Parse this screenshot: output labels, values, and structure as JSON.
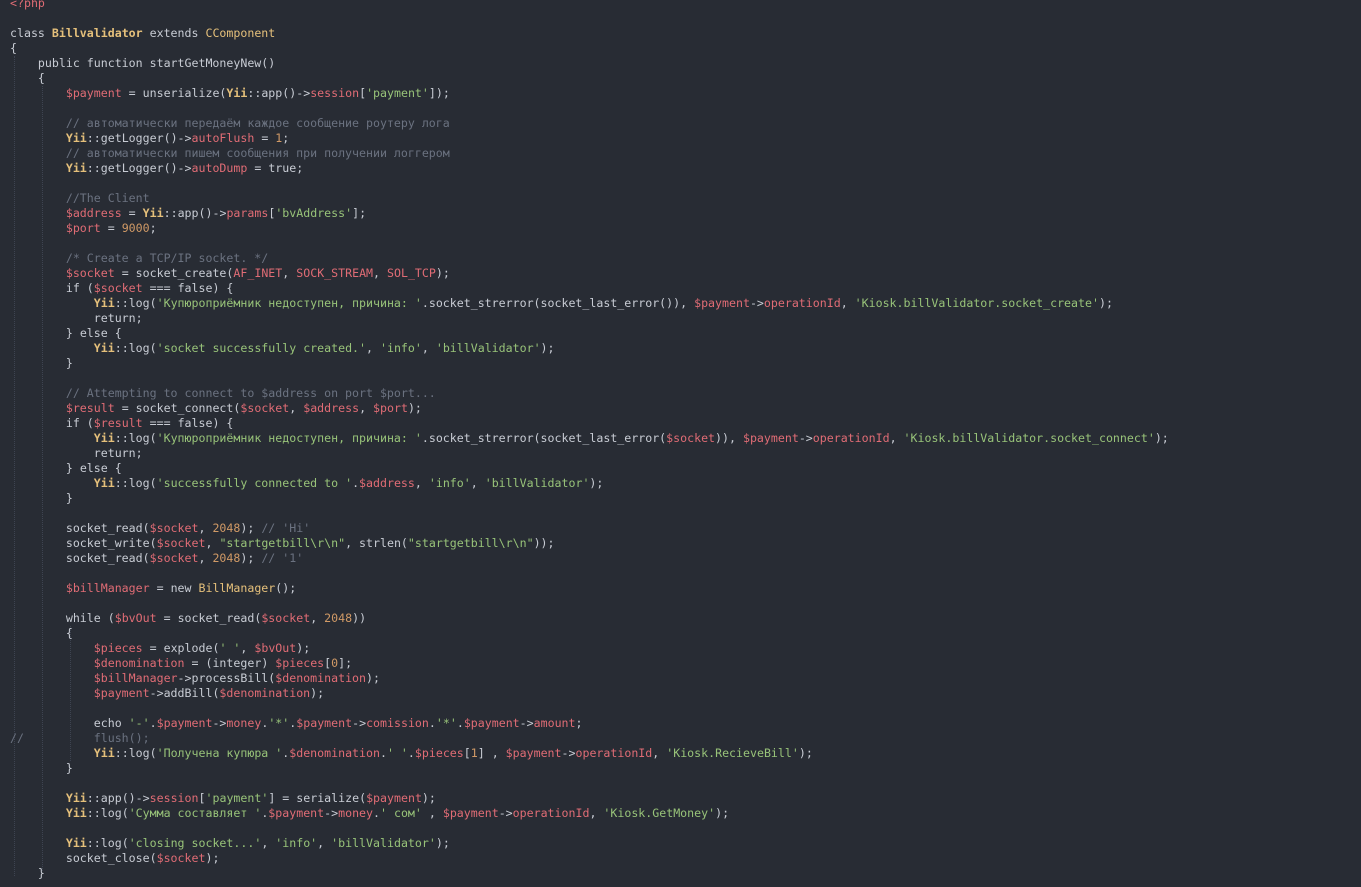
{
  "colors": {
    "background": "#282c34",
    "keyword": "#c8ccd4",
    "variable": "#e06c75",
    "class": "#e5c07b",
    "string": "#98c379",
    "number": "#d19a66",
    "comment": "#6b7280"
  },
  "lines": [
    [
      [
        "tag",
        "<?php"
      ]
    ],
    [],
    [
      [
        "kw",
        "class "
      ],
      [
        "cls",
        "Billvalidator"
      ],
      [
        "kw",
        " extends "
      ],
      [
        "typ",
        "CComponent"
      ]
    ],
    [
      [
        "plain",
        "{"
      ]
    ],
    [
      [
        "plain",
        "    "
      ],
      [
        "kw",
        "public function "
      ],
      [
        "fn",
        "startGetMoneyNew()"
      ]
    ],
    [
      [
        "plain",
        "    {"
      ]
    ],
    [
      [
        "plain",
        "        "
      ],
      [
        "var",
        "$payment"
      ],
      [
        "op",
        " = "
      ],
      [
        "fn",
        "unserialize("
      ],
      [
        "cls",
        "Yii"
      ],
      [
        "op",
        "::"
      ],
      [
        "fn",
        "app()->"
      ],
      [
        "prop",
        "session"
      ],
      [
        "plain",
        "["
      ],
      [
        "str",
        "'payment'"
      ],
      [
        "plain",
        "]);"
      ]
    ],
    [],
    [
      [
        "plain",
        "        "
      ],
      [
        "com",
        "// автоматически передаём каждое сообщение роутеру лога"
      ]
    ],
    [
      [
        "plain",
        "        "
      ],
      [
        "cls",
        "Yii"
      ],
      [
        "op",
        "::"
      ],
      [
        "fn",
        "getLogger()->"
      ],
      [
        "prop",
        "autoFlush"
      ],
      [
        "op",
        " = "
      ],
      [
        "num",
        "1"
      ],
      [
        "plain",
        ";"
      ]
    ],
    [
      [
        "plain",
        "        "
      ],
      [
        "com",
        "// автоматически пишем сообщения при получении логгером"
      ]
    ],
    [
      [
        "plain",
        "        "
      ],
      [
        "cls",
        "Yii"
      ],
      [
        "op",
        "::"
      ],
      [
        "fn",
        "getLogger()->"
      ],
      [
        "prop",
        "autoDump"
      ],
      [
        "op",
        " = "
      ],
      [
        "kw",
        "true"
      ],
      [
        "plain",
        ";"
      ]
    ],
    [],
    [
      [
        "plain",
        "        "
      ],
      [
        "com",
        "//The Client"
      ]
    ],
    [
      [
        "plain",
        "        "
      ],
      [
        "var",
        "$address"
      ],
      [
        "op",
        " = "
      ],
      [
        "cls",
        "Yii"
      ],
      [
        "op",
        "::"
      ],
      [
        "fn",
        "app()->"
      ],
      [
        "prop",
        "params"
      ],
      [
        "plain",
        "["
      ],
      [
        "str",
        "'bvAddress'"
      ],
      [
        "plain",
        "];"
      ]
    ],
    [
      [
        "plain",
        "        "
      ],
      [
        "var",
        "$port"
      ],
      [
        "op",
        " = "
      ],
      [
        "num",
        "9000"
      ],
      [
        "plain",
        ";"
      ]
    ],
    [],
    [
      [
        "plain",
        "        "
      ],
      [
        "com",
        "/* Create a TCP/IP socket. */"
      ]
    ],
    [
      [
        "plain",
        "        "
      ],
      [
        "var",
        "$socket"
      ],
      [
        "op",
        " = "
      ],
      [
        "fn",
        "socket_create("
      ],
      [
        "var",
        "AF_INET"
      ],
      [
        "plain",
        ", "
      ],
      [
        "var",
        "SOCK_STREAM"
      ],
      [
        "plain",
        ", "
      ],
      [
        "var",
        "SOL_TCP"
      ],
      [
        "plain",
        ");"
      ]
    ],
    [
      [
        "plain",
        "        "
      ],
      [
        "kw",
        "if "
      ],
      [
        "plain",
        "("
      ],
      [
        "var",
        "$socket"
      ],
      [
        "op",
        " === "
      ],
      [
        "kw",
        "false"
      ],
      [
        "plain",
        ") {"
      ]
    ],
    [
      [
        "plain",
        "            "
      ],
      [
        "cls",
        "Yii"
      ],
      [
        "op",
        "::"
      ],
      [
        "fn",
        "log("
      ],
      [
        "str",
        "'Купюроприёмник недоступен, причина: '"
      ],
      [
        "plain",
        "."
      ],
      [
        "fn",
        "socket_strerror(socket_last_error()), "
      ],
      [
        "var",
        "$payment"
      ],
      [
        "op",
        "->"
      ],
      [
        "prop",
        "operationId"
      ],
      [
        "plain",
        ", "
      ],
      [
        "str",
        "'Kiosk.billValidator.socket_create'"
      ],
      [
        "plain",
        ");"
      ]
    ],
    [
      [
        "plain",
        "            "
      ],
      [
        "kw",
        "return"
      ],
      [
        "plain",
        ";"
      ]
    ],
    [
      [
        "plain",
        "        } "
      ],
      [
        "kw",
        "else"
      ],
      [
        "plain",
        " {"
      ]
    ],
    [
      [
        "plain",
        "            "
      ],
      [
        "cls",
        "Yii"
      ],
      [
        "op",
        "::"
      ],
      [
        "fn",
        "log("
      ],
      [
        "str",
        "'socket successfully created.'"
      ],
      [
        "plain",
        ", "
      ],
      [
        "str",
        "'info'"
      ],
      [
        "plain",
        ", "
      ],
      [
        "str",
        "'billValidator'"
      ],
      [
        "plain",
        ");"
      ]
    ],
    [
      [
        "plain",
        "        }"
      ]
    ],
    [],
    [
      [
        "plain",
        "        "
      ],
      [
        "com",
        "// Attempting to connect to $address on port $port..."
      ]
    ],
    [
      [
        "plain",
        "        "
      ],
      [
        "var",
        "$result"
      ],
      [
        "op",
        " = "
      ],
      [
        "fn",
        "socket_connect("
      ],
      [
        "var",
        "$socket"
      ],
      [
        "plain",
        ", "
      ],
      [
        "var",
        "$address"
      ],
      [
        "plain",
        ", "
      ],
      [
        "var",
        "$port"
      ],
      [
        "plain",
        ");"
      ]
    ],
    [
      [
        "plain",
        "        "
      ],
      [
        "kw",
        "if "
      ],
      [
        "plain",
        "("
      ],
      [
        "var",
        "$result"
      ],
      [
        "op",
        " === "
      ],
      [
        "kw",
        "false"
      ],
      [
        "plain",
        ") {"
      ]
    ],
    [
      [
        "plain",
        "            "
      ],
      [
        "cls",
        "Yii"
      ],
      [
        "op",
        "::"
      ],
      [
        "fn",
        "log("
      ],
      [
        "str",
        "'Купюроприёмник недоступен, причина: '"
      ],
      [
        "plain",
        "."
      ],
      [
        "fn",
        "socket_strerror(socket_last_error("
      ],
      [
        "var",
        "$socket"
      ],
      [
        "plain",
        ")), "
      ],
      [
        "var",
        "$payment"
      ],
      [
        "op",
        "->"
      ],
      [
        "prop",
        "operationId"
      ],
      [
        "plain",
        ", "
      ],
      [
        "str",
        "'Kiosk.billValidator.socket_connect'"
      ],
      [
        "plain",
        ");"
      ]
    ],
    [
      [
        "plain",
        "            "
      ],
      [
        "kw",
        "return"
      ],
      [
        "plain",
        ";"
      ]
    ],
    [
      [
        "plain",
        "        } "
      ],
      [
        "kw",
        "else"
      ],
      [
        "plain",
        " {"
      ]
    ],
    [
      [
        "plain",
        "            "
      ],
      [
        "cls",
        "Yii"
      ],
      [
        "op",
        "::"
      ],
      [
        "fn",
        "log("
      ],
      [
        "str",
        "'successfully connected to '"
      ],
      [
        "plain",
        "."
      ],
      [
        "var",
        "$address"
      ],
      [
        "plain",
        ", "
      ],
      [
        "str",
        "'info'"
      ],
      [
        "plain",
        ", "
      ],
      [
        "str",
        "'billValidator'"
      ],
      [
        "plain",
        ");"
      ]
    ],
    [
      [
        "plain",
        "        }"
      ]
    ],
    [],
    [
      [
        "plain",
        "        "
      ],
      [
        "fn",
        "socket_read("
      ],
      [
        "var",
        "$socket"
      ],
      [
        "plain",
        ", "
      ],
      [
        "num",
        "2048"
      ],
      [
        "plain",
        "); "
      ],
      [
        "com",
        "// 'Hi'"
      ]
    ],
    [
      [
        "plain",
        "        "
      ],
      [
        "fn",
        "socket_write("
      ],
      [
        "var",
        "$socket"
      ],
      [
        "plain",
        ", "
      ],
      [
        "str",
        "\"startgetbill\\r\\n\""
      ],
      [
        "plain",
        ", "
      ],
      [
        "fn",
        "strlen("
      ],
      [
        "str",
        "\"startgetbill\\r\\n\""
      ],
      [
        "plain",
        "));"
      ]
    ],
    [
      [
        "plain",
        "        "
      ],
      [
        "fn",
        "socket_read("
      ],
      [
        "var",
        "$socket"
      ],
      [
        "plain",
        ", "
      ],
      [
        "num",
        "2048"
      ],
      [
        "plain",
        "); "
      ],
      [
        "com",
        "// '1'"
      ]
    ],
    [],
    [
      [
        "plain",
        "        "
      ],
      [
        "var",
        "$billManager"
      ],
      [
        "op",
        " = "
      ],
      [
        "kw",
        "new "
      ],
      [
        "typ",
        "BillManager"
      ],
      [
        "plain",
        "();"
      ]
    ],
    [],
    [
      [
        "plain",
        "        "
      ],
      [
        "kw",
        "while "
      ],
      [
        "plain",
        "("
      ],
      [
        "var",
        "$bvOut"
      ],
      [
        "op",
        " = "
      ],
      [
        "fn",
        "socket_read("
      ],
      [
        "var",
        "$socket"
      ],
      [
        "plain",
        ", "
      ],
      [
        "num",
        "2048"
      ],
      [
        "plain",
        "))"
      ]
    ],
    [
      [
        "plain",
        "        {"
      ]
    ],
    [
      [
        "plain",
        "            "
      ],
      [
        "var",
        "$pieces"
      ],
      [
        "op",
        " = "
      ],
      [
        "fn",
        "explode("
      ],
      [
        "str",
        "' '"
      ],
      [
        "plain",
        ", "
      ],
      [
        "var",
        "$bvOut"
      ],
      [
        "plain",
        ");"
      ]
    ],
    [
      [
        "plain",
        "            "
      ],
      [
        "var",
        "$denomination"
      ],
      [
        "op",
        " = "
      ],
      [
        "plain",
        "("
      ],
      [
        "kw",
        "integer"
      ],
      [
        "plain",
        ") "
      ],
      [
        "var",
        "$pieces"
      ],
      [
        "plain",
        "["
      ],
      [
        "num",
        "0"
      ],
      [
        "plain",
        "];"
      ]
    ],
    [
      [
        "plain",
        "            "
      ],
      [
        "var",
        "$billManager"
      ],
      [
        "op",
        "->"
      ],
      [
        "fn",
        "processBill("
      ],
      [
        "var",
        "$denomination"
      ],
      [
        "plain",
        ");"
      ]
    ],
    [
      [
        "plain",
        "            "
      ],
      [
        "var",
        "$payment"
      ],
      [
        "op",
        "->"
      ],
      [
        "fn",
        "addBill("
      ],
      [
        "var",
        "$denomination"
      ],
      [
        "plain",
        ");"
      ]
    ],
    [],
    [
      [
        "plain",
        "            "
      ],
      [
        "kw",
        "echo "
      ],
      [
        "str",
        "'-'"
      ],
      [
        "plain",
        "."
      ],
      [
        "var",
        "$payment"
      ],
      [
        "op",
        "->"
      ],
      [
        "prop",
        "money"
      ],
      [
        "plain",
        "."
      ],
      [
        "str",
        "'*'"
      ],
      [
        "plain",
        "."
      ],
      [
        "var",
        "$payment"
      ],
      [
        "op",
        "->"
      ],
      [
        "prop",
        "comission"
      ],
      [
        "plain",
        "."
      ],
      [
        "str",
        "'*'"
      ],
      [
        "plain",
        "."
      ],
      [
        "var",
        "$payment"
      ],
      [
        "op",
        "->"
      ],
      [
        "prop",
        "amount"
      ],
      [
        "plain",
        ";"
      ]
    ],
    [
      [
        "com",
        "//          flush();"
      ]
    ],
    [
      [
        "plain",
        "            "
      ],
      [
        "cls",
        "Yii"
      ],
      [
        "op",
        "::"
      ],
      [
        "fn",
        "log("
      ],
      [
        "str",
        "'Получена купюра '"
      ],
      [
        "plain",
        "."
      ],
      [
        "var",
        "$denomination"
      ],
      [
        "plain",
        "."
      ],
      [
        "str",
        "' '"
      ],
      [
        "plain",
        "."
      ],
      [
        "var",
        "$pieces"
      ],
      [
        "plain",
        "["
      ],
      [
        "num",
        "1"
      ],
      [
        "plain",
        "] , "
      ],
      [
        "var",
        "$payment"
      ],
      [
        "op",
        "->"
      ],
      [
        "prop",
        "operationId"
      ],
      [
        "plain",
        ", "
      ],
      [
        "str",
        "'Kiosk.RecieveBill'"
      ],
      [
        "plain",
        ");"
      ]
    ],
    [
      [
        "plain",
        "        }"
      ]
    ],
    [],
    [
      [
        "plain",
        "        "
      ],
      [
        "cls",
        "Yii"
      ],
      [
        "op",
        "::"
      ],
      [
        "fn",
        "app()->"
      ],
      [
        "prop",
        "session"
      ],
      [
        "plain",
        "["
      ],
      [
        "str",
        "'payment'"
      ],
      [
        "plain",
        "]"
      ],
      [
        "op",
        " = "
      ],
      [
        "fn",
        "serialize("
      ],
      [
        "var",
        "$payment"
      ],
      [
        "plain",
        ");"
      ]
    ],
    [
      [
        "plain",
        "        "
      ],
      [
        "cls",
        "Yii"
      ],
      [
        "op",
        "::"
      ],
      [
        "fn",
        "log("
      ],
      [
        "str",
        "'Сумма составляет '"
      ],
      [
        "plain",
        "."
      ],
      [
        "var",
        "$payment"
      ],
      [
        "op",
        "->"
      ],
      [
        "prop",
        "money"
      ],
      [
        "plain",
        "."
      ],
      [
        "str",
        "' сом'"
      ],
      [
        "plain",
        " , "
      ],
      [
        "var",
        "$payment"
      ],
      [
        "op",
        "->"
      ],
      [
        "prop",
        "operationId"
      ],
      [
        "plain",
        ", "
      ],
      [
        "str",
        "'Kiosk.GetMoney'"
      ],
      [
        "plain",
        ");"
      ]
    ],
    [],
    [
      [
        "plain",
        "        "
      ],
      [
        "cls",
        "Yii"
      ],
      [
        "op",
        "::"
      ],
      [
        "fn",
        "log("
      ],
      [
        "str",
        "'closing socket...'"
      ],
      [
        "plain",
        ", "
      ],
      [
        "str",
        "'info'"
      ],
      [
        "plain",
        ", "
      ],
      [
        "str",
        "'billValidator'"
      ],
      [
        "plain",
        ");"
      ]
    ],
    [
      [
        "plain",
        "        "
      ],
      [
        "fn",
        "socket_close("
      ],
      [
        "var",
        "$socket"
      ],
      [
        "plain",
        ");"
      ]
    ],
    [
      [
        "plain",
        "    }"
      ]
    ]
  ]
}
